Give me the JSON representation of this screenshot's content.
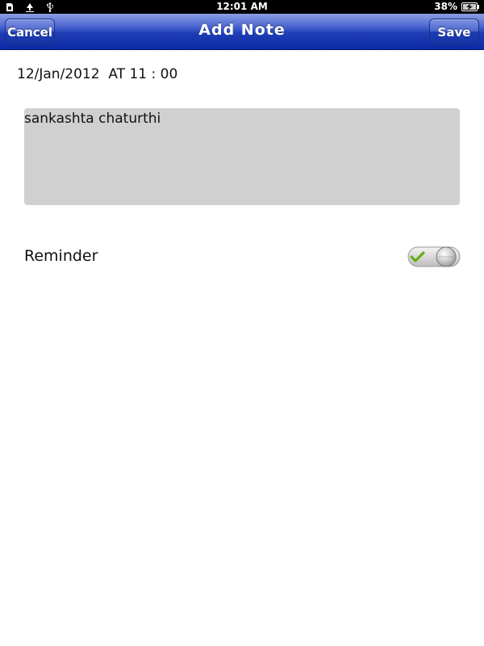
{
  "status_bar": {
    "time": "12:01 AM",
    "battery_percent": "38%",
    "left_icons": [
      "sim-card-icon",
      "download-icon",
      "usb-icon"
    ],
    "right_icons": [
      "battery-charging-icon"
    ]
  },
  "nav_bar": {
    "title": "Add Note",
    "cancel_label": "Cancel",
    "save_label": "Save"
  },
  "note": {
    "date_time": "12/Jan/2012  AT 11 : 00",
    "text": "sankashta chaturthi"
  },
  "reminder": {
    "label": "Reminder",
    "enabled": true
  },
  "colors": {
    "nav_bar_blue": "#0a2aa4",
    "note_box_gray": "#d0d0d0",
    "check_green": "#6aac1a"
  }
}
